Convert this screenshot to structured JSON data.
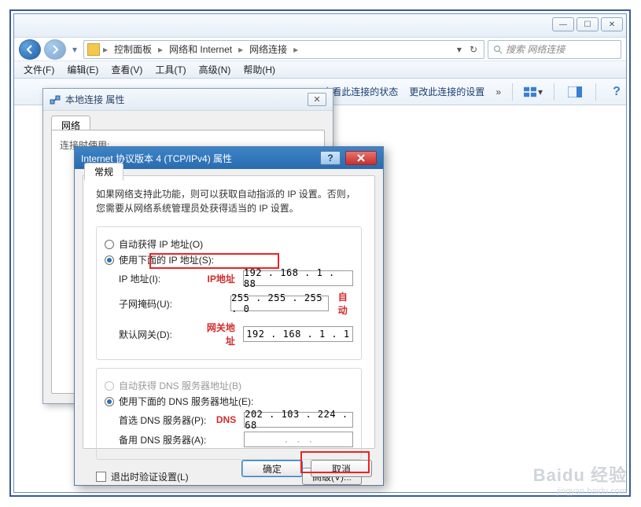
{
  "explorer": {
    "breadcrumb": [
      "控制面板",
      "网络和 Internet",
      "网络连接"
    ],
    "search_placeholder": "搜索 网络连接",
    "menu": [
      "文件(F)",
      "编辑(E)",
      "查看(V)",
      "工具(T)",
      "高级(N)",
      "帮助(H)"
    ],
    "toolbar": {
      "view_status": "查看此连接的状态",
      "change_settings": "更改此连接的设置"
    }
  },
  "prop_dialog": {
    "title": "本地连接 属性",
    "tab": "网络",
    "partial_text": "连接时使用:"
  },
  "ipv4": {
    "title": "Internet 协议版本 4 (TCP/IPv4) 属性",
    "tab": "常规",
    "desc": "如果网络支持此功能，则可以获取自动指派的 IP 设置。否则，您需要从网络系统管理员处获得适当的 IP 设置。",
    "radio_auto_ip": "自动获得 IP 地址(O)",
    "radio_manual_ip": "使用下面的 IP 地址(S):",
    "fields": {
      "ip_label": "IP 地址(I):",
      "ip_value": "192 . 168 .  1  .  88",
      "mask_label": "子网掩码(U):",
      "mask_value": "255 . 255 . 255 .  0",
      "gw_label": "默认网关(D):",
      "gw_value": "192 . 168 .  1  .  1"
    },
    "annotations": {
      "ip": "IP地址",
      "auto": "自动",
      "gw": "网关地址",
      "dns": "DNS"
    },
    "radio_auto_dns": "自动获得 DNS 服务器地址(B)",
    "radio_manual_dns": "使用下面的 DNS 服务器地址(E):",
    "dns": {
      "pref_label": "首选 DNS 服务器(P):",
      "pref_value": "202 . 103 . 224 . 68",
      "alt_label": "备用 DNS 服务器(A):",
      "alt_value": " .   .   . "
    },
    "checkbox": "退出时验证设置(L)",
    "advanced": "高级(V)...",
    "ok": "确定",
    "cancel": "取消"
  },
  "watermark": {
    "brand": "Baidu 经验",
    "url": "jingyan.baidu.com"
  }
}
